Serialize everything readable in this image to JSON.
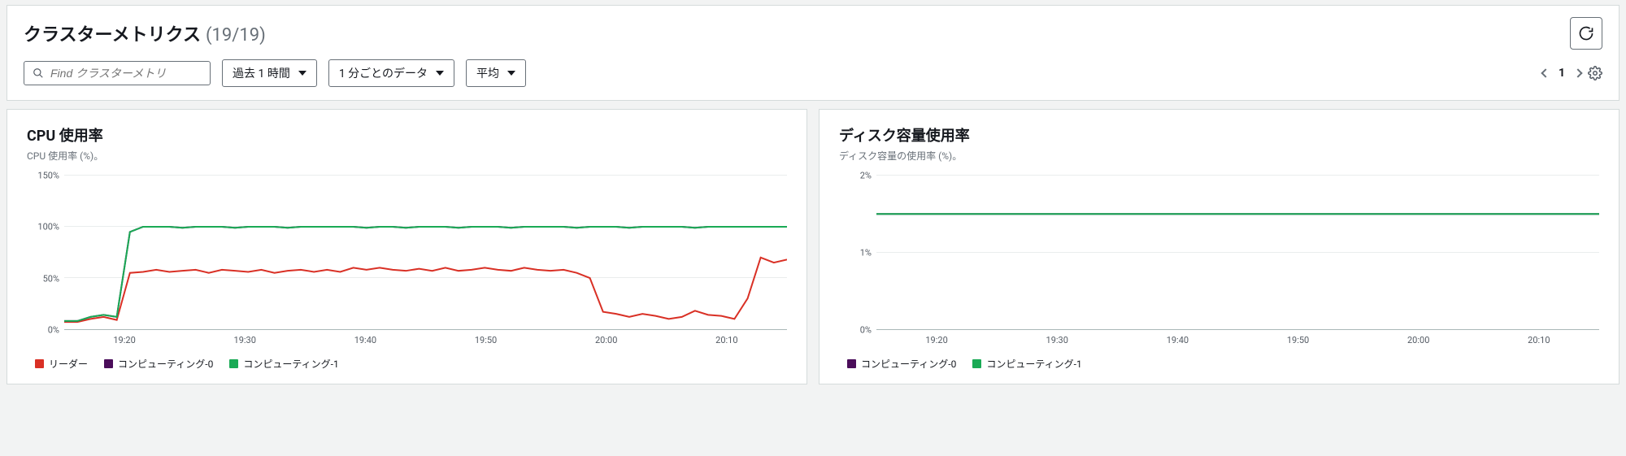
{
  "header": {
    "title": "クラスターメトリクス",
    "count": "(19/19)",
    "search_placeholder": "Find クラスターメトリ",
    "range_label": "過去 1 時間",
    "interval_label": "1 分ごとのデータ",
    "agg_label": "平均",
    "page": "1"
  },
  "chart_data": [
    {
      "type": "line",
      "title": "CPU 使用率",
      "subtitle": "CPU 使用率 (%)。",
      "ylabel": "%",
      "ylim": [
        0,
        150
      ],
      "y_ticks": [
        0,
        50,
        100,
        150
      ],
      "x_ticks": [
        "19:20",
        "19:30",
        "19:40",
        "19:50",
        "20:00",
        "20:10"
      ],
      "series": [
        {
          "name": "リーダー",
          "color": "#d93025",
          "values": [
            7,
            7,
            10,
            12,
            9,
            55,
            56,
            58,
            56,
            57,
            58,
            55,
            58,
            57,
            56,
            58,
            55,
            57,
            58,
            56,
            58,
            56,
            60,
            58,
            60,
            58,
            57,
            59,
            57,
            60,
            57,
            58,
            60,
            58,
            57,
            60,
            58,
            57,
            58,
            55,
            50,
            17,
            15,
            12,
            15,
            13,
            10,
            12,
            18,
            14,
            13,
            10,
            30,
            70,
            65,
            68
          ]
        },
        {
          "name": "コンピューティング-0",
          "color": "#4b0d5a",
          "values": [
            8,
            8,
            12,
            14,
            12,
            95,
            100,
            100,
            100,
            99,
            100,
            100,
            100,
            99,
            100,
            100,
            100,
            99,
            100,
            100,
            100,
            100,
            100,
            99,
            100,
            100,
            99,
            100,
            100,
            100,
            99,
            100,
            100,
            100,
            99,
            100,
            100,
            100,
            100,
            99,
            100,
            100,
            100,
            99,
            100,
            100,
            100,
            100,
            99,
            100,
            100,
            100,
            100,
            100,
            100,
            100
          ]
        },
        {
          "name": "コンピューティング-1",
          "color": "#1aaa55",
          "values": [
            8,
            8,
            12,
            14,
            12,
            95,
            100,
            100,
            100,
            99,
            100,
            100,
            100,
            99,
            100,
            100,
            100,
            99,
            100,
            100,
            100,
            100,
            100,
            99,
            100,
            100,
            99,
            100,
            100,
            100,
            99,
            100,
            100,
            100,
            99,
            100,
            100,
            100,
            100,
            99,
            100,
            100,
            100,
            99,
            100,
            100,
            100,
            100,
            99,
            100,
            100,
            100,
            100,
            100,
            100,
            100
          ]
        }
      ]
    },
    {
      "type": "line",
      "title": "ディスク容量使用率",
      "subtitle": "ディスク容量の使用率 (%)。",
      "ylabel": "%",
      "ylim": [
        0,
        2
      ],
      "y_ticks": [
        0,
        1,
        2
      ],
      "x_ticks": [
        "19:20",
        "19:30",
        "19:40",
        "19:50",
        "20:00",
        "20:10"
      ],
      "series": [
        {
          "name": "コンピューティング-0",
          "color": "#4b0d5a",
          "values": [
            1.5,
            1.5,
            1.5,
            1.5,
            1.5,
            1.5,
            1.5,
            1.5,
            1.5,
            1.5,
            1.5,
            1.5,
            1.5,
            1.5,
            1.5,
            1.5,
            1.5,
            1.5,
            1.5,
            1.5,
            1.5,
            1.5,
            1.5,
            1.5,
            1.5,
            1.5,
            1.5,
            1.5,
            1.5,
            1.5,
            1.5,
            1.5,
            1.5,
            1.5,
            1.5,
            1.5,
            1.5,
            1.5,
            1.5,
            1.5,
            1.5,
            1.5,
            1.5,
            1.5,
            1.5,
            1.5,
            1.5,
            1.5,
            1.5,
            1.5,
            1.5,
            1.5,
            1.5,
            1.5,
            1.5,
            1.5
          ]
        },
        {
          "name": "コンピューティング-1",
          "color": "#1aaa55",
          "values": [
            1.5,
            1.5,
            1.5,
            1.5,
            1.5,
            1.5,
            1.5,
            1.5,
            1.5,
            1.5,
            1.5,
            1.5,
            1.5,
            1.5,
            1.5,
            1.5,
            1.5,
            1.5,
            1.5,
            1.5,
            1.5,
            1.5,
            1.5,
            1.5,
            1.5,
            1.5,
            1.5,
            1.5,
            1.5,
            1.5,
            1.5,
            1.5,
            1.5,
            1.5,
            1.5,
            1.5,
            1.5,
            1.5,
            1.5,
            1.5,
            1.5,
            1.5,
            1.5,
            1.5,
            1.5,
            1.5,
            1.5,
            1.5,
            1.5,
            1.5,
            1.5,
            1.5,
            1.5,
            1.5,
            1.5,
            1.5
          ]
        }
      ]
    }
  ]
}
